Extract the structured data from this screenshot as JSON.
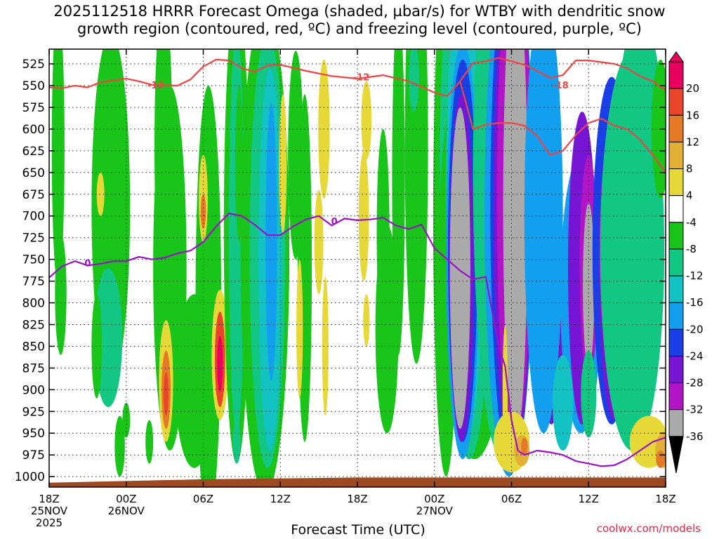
{
  "title_line1": "2025112518 HRRR Forecast Omega (shaded, µbar/s) for WTBY with dendritic snow",
  "title_line2": "growth region (contoured, red, ºC) and freezing level (contoured, purple, ºC)",
  "credit": "coolwx.com/models",
  "chart_data": {
    "type": "heatmap",
    "xlabel": "Forecast Time (UTC)",
    "ylabel": "",
    "x_range_hours": [
      0,
      48
    ],
    "x_ticks": [
      {
        "h": 0,
        "lines": [
          "18Z",
          "25NOV",
          "2025"
        ]
      },
      {
        "h": 6,
        "lines": [
          "00Z",
          "26NOV"
        ]
      },
      {
        "h": 12,
        "lines": [
          "06Z"
        ]
      },
      {
        "h": 18,
        "lines": [
          "12Z"
        ]
      },
      {
        "h": 24,
        "lines": [
          "18Z"
        ]
      },
      {
        "h": 30,
        "lines": [
          "00Z",
          "27NOV"
        ]
      },
      {
        "h": 36,
        "lines": [
          "06Z"
        ]
      },
      {
        "h": 42,
        "lines": [
          "12Z"
        ]
      },
      {
        "h": 48,
        "lines": [
          "18Z"
        ]
      }
    ],
    "y_axis": "pressure (mb), inverted",
    "y_range": [
      1012,
      508
    ],
    "y_ticks": [
      525,
      550,
      575,
      600,
      625,
      650,
      675,
      700,
      725,
      750,
      775,
      800,
      825,
      850,
      875,
      900,
      925,
      950,
      975,
      1000
    ],
    "colorbar": {
      "levels": [
        20,
        16,
        12,
        8,
        4,
        -4,
        -8,
        -12,
        -16,
        -20,
        -24,
        -28,
        -32,
        -36
      ],
      "colors": [
        "#e8005f",
        "#e8452b",
        "#e47a25",
        "#e3b037",
        "#e6d836",
        "#ffffff",
        "#19c519",
        "#12c683",
        "#13c3c3",
        "#129ff0",
        "#1b3fe6",
        "#7715d4",
        "#b214c8",
        "#aaaaaa",
        "#000000"
      ]
    },
    "dgz_contours": [
      {
        "level": -12,
        "label": "-12",
        "points": [
          [
            0,
            552
          ],
          [
            1,
            553
          ],
          [
            2,
            550
          ],
          [
            3,
            552
          ],
          [
            4,
            546
          ],
          [
            6,
            542
          ],
          [
            7,
            545
          ],
          [
            8,
            549
          ],
          [
            10,
            550
          ],
          [
            11,
            543
          ],
          [
            12,
            528
          ],
          [
            13,
            520
          ],
          [
            14,
            521
          ],
          [
            15,
            530
          ],
          [
            16,
            534
          ],
          [
            17,
            527
          ],
          [
            18,
            526
          ],
          [
            20,
            533
          ],
          [
            22,
            539
          ],
          [
            24,
            542
          ],
          [
            26,
            538
          ],
          [
            28,
            545
          ],
          [
            30,
            558
          ],
          [
            31,
            562
          ],
          [
            32,
            545
          ],
          [
            33,
            524
          ],
          [
            34,
            522
          ],
          [
            35,
            518
          ],
          [
            36,
            522
          ],
          [
            37,
            526
          ],
          [
            38,
            533
          ],
          [
            39,
            541
          ],
          [
            40,
            538
          ],
          [
            41,
            521
          ],
          [
            42,
            521
          ],
          [
            44,
            525
          ],
          [
            45,
            530
          ],
          [
            46,
            539
          ],
          [
            47,
            545
          ],
          [
            48,
            555
          ]
        ]
      },
      {
        "level": -18,
        "label": "-18",
        "points": [
          [
            32,
            545
          ],
          [
            33,
            600
          ],
          [
            34,
            595
          ],
          [
            35,
            593
          ],
          [
            36,
            593
          ],
          [
            37,
            596
          ],
          [
            38,
            608
          ],
          [
            39,
            630
          ],
          [
            40,
            625
          ],
          [
            41,
            607
          ],
          [
            42,
            593
          ],
          [
            43,
            588
          ],
          [
            44,
            596
          ],
          [
            45,
            600
          ],
          [
            46,
            612
          ],
          [
            47,
            630
          ],
          [
            48,
            650
          ]
        ]
      }
    ],
    "freezing_contour": {
      "level": 0,
      "label": "0",
      "points": [
        [
          0,
          771
        ],
        [
          1,
          758
        ],
        [
          2,
          752
        ],
        [
          3,
          757
        ],
        [
          4,
          755
        ],
        [
          5,
          752
        ],
        [
          6,
          752
        ],
        [
          7,
          747
        ],
        [
          8,
          750
        ],
        [
          9,
          748
        ],
        [
          10,
          743
        ],
        [
          11,
          740
        ],
        [
          12,
          730
        ],
        [
          13,
          712
        ],
        [
          14,
          697
        ],
        [
          15,
          700
        ],
        [
          16,
          710
        ],
        [
          17,
          722
        ],
        [
          18,
          722
        ],
        [
          19,
          712
        ],
        [
          20,
          704
        ],
        [
          21,
          700
        ],
        [
          22,
          711
        ],
        [
          23,
          703
        ],
        [
          24,
          705
        ],
        [
          25,
          704
        ],
        [
          26,
          702
        ],
        [
          27,
          711
        ],
        [
          28,
          715
        ],
        [
          29,
          710
        ],
        [
          30,
          737
        ],
        [
          31,
          750
        ],
        [
          32,
          763
        ],
        [
          33,
          773
        ],
        [
          34,
          770
        ],
        [
          35,
          850
        ],
        [
          35.5,
          873
        ],
        [
          36,
          935
        ],
        [
          36.5,
          970
        ],
        [
          37,
          975
        ],
        [
          38,
          970
        ],
        [
          39,
          972
        ],
        [
          40,
          975
        ],
        [
          41,
          982
        ],
        [
          42,
          985
        ],
        [
          43,
          988
        ],
        [
          44,
          987
        ],
        [
          45,
          980
        ],
        [
          46,
          970
        ],
        [
          47,
          960
        ],
        [
          48,
          955
        ]
      ]
    },
    "terrain_mb": [
      [
        0,
        1007
      ],
      [
        12,
        1003
      ],
      [
        24,
        1001
      ],
      [
        36,
        1001
      ],
      [
        48,
        1001
      ]
    ]
  }
}
